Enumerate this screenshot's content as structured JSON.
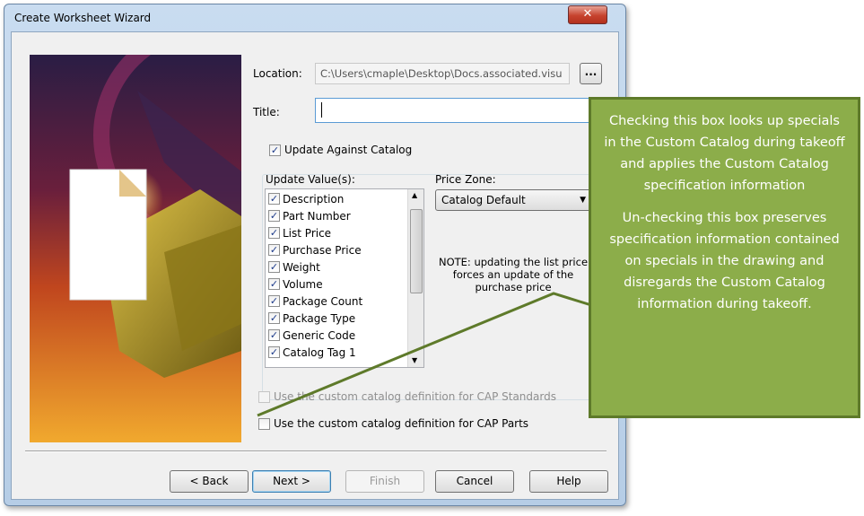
{
  "window": {
    "title": "Create Worksheet Wizard",
    "close_label": "✕"
  },
  "location": {
    "label": "Location:",
    "value": "C:\\Users\\cmaple\\Desktop\\Docs.associated.visu",
    "browse_label": "..."
  },
  "title_field": {
    "label": "Title:",
    "value": ""
  },
  "update_catalog": {
    "label": "Update Against Catalog",
    "checked": true
  },
  "update_values": {
    "label": "Update Value(s):",
    "items": [
      "Description",
      "Part Number",
      "List Price",
      "Purchase Price",
      "Weight",
      "Volume",
      "Package Count",
      "Package Type",
      "Generic Code",
      "Catalog Tag 1"
    ]
  },
  "price_zone": {
    "label": "Price Zone:",
    "selected": "Catalog Default"
  },
  "note": {
    "line1": "NOTE: updating the list price",
    "line2": "forces an update of the",
    "line3": "purchase price"
  },
  "cap_standards": {
    "label": "Use the custom catalog definition for CAP Standards"
  },
  "cap_parts": {
    "label": "Use the custom catalog definition for CAP Parts"
  },
  "buttons": {
    "back": "< Back",
    "next": "Next >",
    "finish": "Finish",
    "cancel": "Cancel",
    "help": "Help"
  },
  "callout": {
    "para1": "Checking this box looks up specials in the Custom Catalog during takeoff and applies the Custom Catalog specification information",
    "para2": "Un-checking this box preserves specification information contained on specials in the drawing and disregards the Custom Catalog information during takeoff."
  },
  "colors": {
    "callout_fill": "#8cad4a",
    "callout_border": "#5e7a2a",
    "pointer_line": "#5e7a2a"
  }
}
